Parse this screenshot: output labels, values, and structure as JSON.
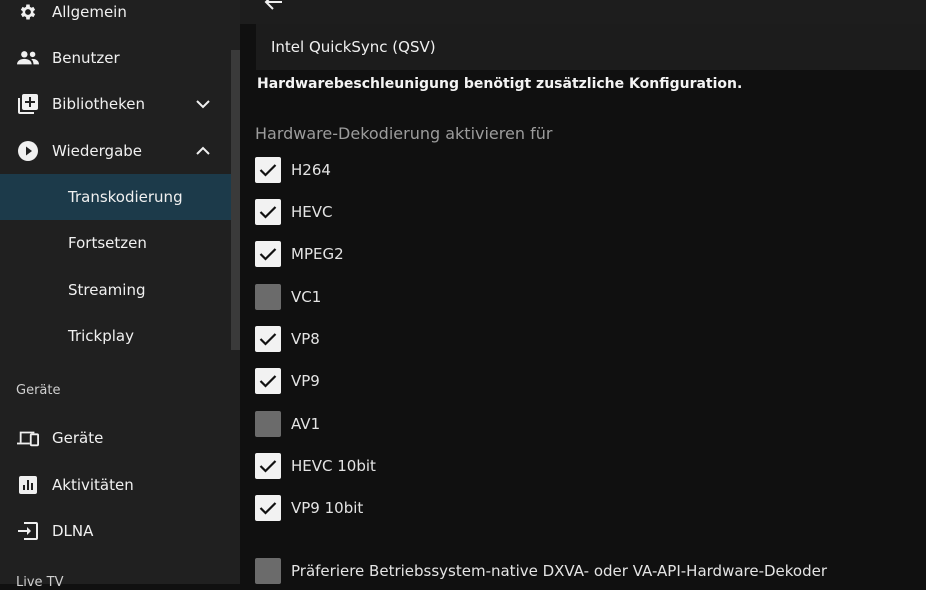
{
  "sidebar": {
    "items": [
      {
        "label": "Allgemein",
        "icon": "gear-icon"
      },
      {
        "label": "Benutzer",
        "icon": "users-icon"
      },
      {
        "label": "Bibliotheken",
        "icon": "library-add-icon",
        "chevron": "chevron-down-icon"
      },
      {
        "label": "Wiedergabe",
        "icon": "play-circle-icon",
        "chevron": "chevron-up-icon"
      }
    ],
    "playback_subitems": [
      {
        "label": "Transkodierung",
        "active": true
      },
      {
        "label": "Fortsetzen"
      },
      {
        "label": "Streaming"
      },
      {
        "label": "Trickplay"
      }
    ],
    "devices_section": {
      "heading": "Geräte",
      "items": [
        {
          "label": "Geräte",
          "icon": "devices-icon"
        },
        {
          "label": "Aktivitäten",
          "icon": "activity-chart-icon"
        },
        {
          "label": "DLNA",
          "icon": "input-icon"
        }
      ]
    },
    "livetv_heading": "Live TV"
  },
  "main": {
    "hw_accel_select": {
      "value": "Intel QuickSync (QSV)"
    },
    "hint": "Hardwarebeschleunigung benötigt zusätzliche Konfiguration.",
    "decode_group_title": "Hardware-Dekodierung aktivieren für",
    "codecs": [
      {
        "label": "H264",
        "checked": true
      },
      {
        "label": "HEVC",
        "checked": true
      },
      {
        "label": "MPEG2",
        "checked": true
      },
      {
        "label": "VC1",
        "checked": false
      },
      {
        "label": "VP8",
        "checked": true
      },
      {
        "label": "VP9",
        "checked": true
      },
      {
        "label": "AV1",
        "checked": false
      },
      {
        "label": "HEVC 10bit",
        "checked": true
      },
      {
        "label": "VP9 10bit",
        "checked": true
      }
    ],
    "prefer_native_decoder": {
      "label": "Präferiere Betriebssystem-native DXVA- oder VA-API-Hardware-Dekoder",
      "checked": false
    }
  },
  "colors": {
    "accent_active": "#1c3a4a",
    "sidebar_bg": "#202020",
    "main_bg": "#101010"
  }
}
